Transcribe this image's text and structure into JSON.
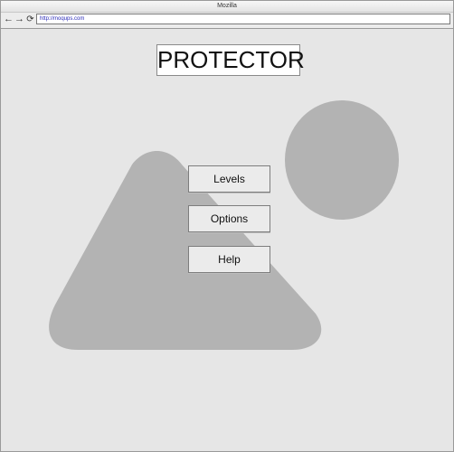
{
  "browser": {
    "window_title": "Mozilla",
    "url": "http://moqups.com",
    "back_icon": "arrow-left-icon",
    "forward_icon": "arrow-right-icon",
    "reload_icon": "reload-icon"
  },
  "page": {
    "title": "PROTECTOR",
    "menu": [
      {
        "label": "Levels"
      },
      {
        "label": "Options"
      },
      {
        "label": "Help"
      }
    ],
    "placeholder_image": "mountain-and-sun-image-placeholder"
  },
  "colors": {
    "background": "#e6e6e6",
    "placeholder_shape": "#b3b3b3",
    "button_face": "#ebebeb",
    "url_text": "#2a2ab8"
  }
}
